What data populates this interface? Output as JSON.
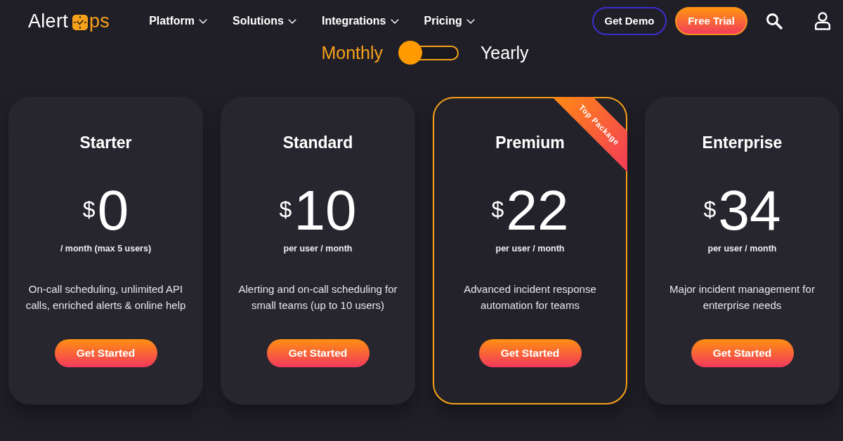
{
  "logo": {
    "text_before": "Alert",
    "text_after": "ps"
  },
  "nav_items": [
    "Platform",
    "Solutions",
    "Integrations",
    "Pricing"
  ],
  "header_buttons": [
    {
      "label": "Get Demo",
      "kind": "outline"
    },
    {
      "label": "Free Trial",
      "kind": "gradient"
    }
  ],
  "billing": [
    {
      "label": "Monthly",
      "selected": true
    },
    {
      "label": "Yearly",
      "selected": false
    }
  ],
  "plans": [
    {
      "name": "Starter",
      "currency": "$",
      "price": "0",
      "period": "/ month (max 5 users)",
      "description": "On-call scheduling, unlimited API calls, enriched alerts & online help",
      "button": "Get Started",
      "featured": false
    },
    {
      "name": "Standard",
      "currency": "$",
      "price": "10",
      "period": "per user / month",
      "description": "Alerting and on-call scheduling for small teams (up to 10 users)",
      "button": "Get Started",
      "featured": false
    },
    {
      "name": "Premium",
      "currency": "$",
      "price": "22",
      "period": "per user / month",
      "description": "Advanced incident response automation for teams",
      "button": "Get Started",
      "featured": true,
      "ribbon": "Top Package"
    },
    {
      "name": "Enterprise",
      "currency": "$",
      "price": "34",
      "period": "per user / month",
      "description": "Major incident management for enterprise needs",
      "button": "Get Started",
      "featured": false
    }
  ]
}
